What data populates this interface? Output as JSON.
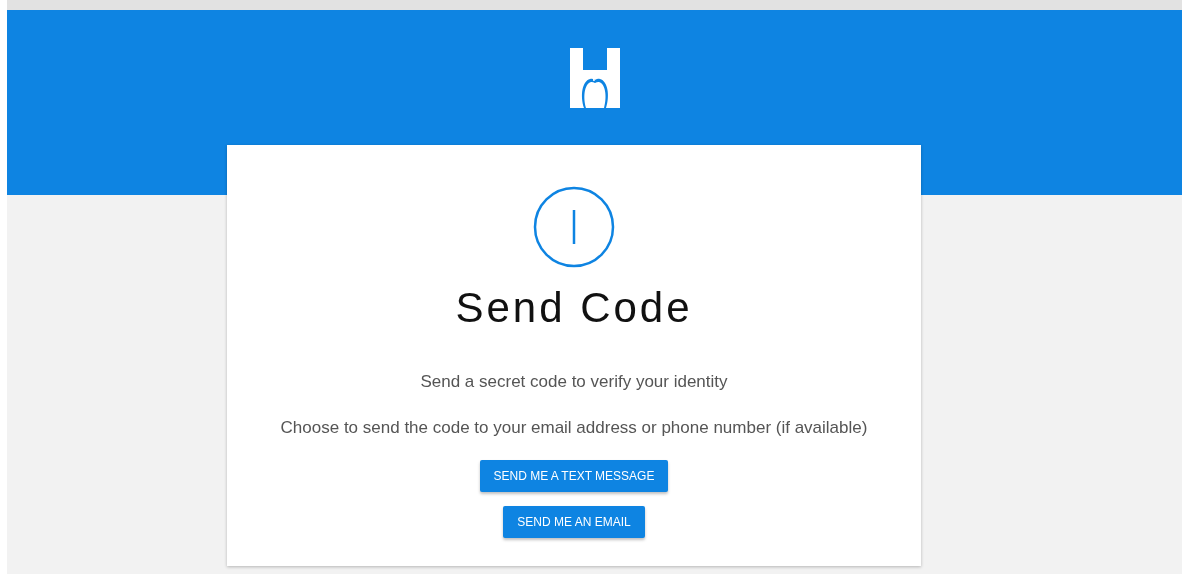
{
  "title": "Send Code",
  "lines": [
    "Send a secret code to verify your identity",
    "Choose to send the code to your email address or phone number (if available)"
  ],
  "buttons": [
    "SEND ME A TEXT MESSAGE",
    "SEND ME AN EMAIL"
  ]
}
